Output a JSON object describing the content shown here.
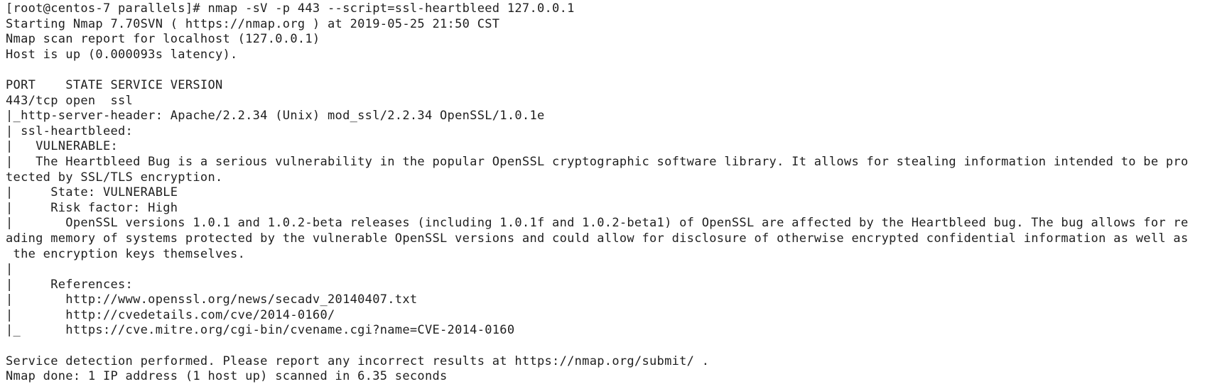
{
  "terminal": {
    "lines": [
      "[root@centos-7 parallels]# nmap -sV -p 443 --script=ssl-heartbleed 127.0.0.1",
      "Starting Nmap 7.70SVN ( https://nmap.org ) at 2019-05-25 21:50 CST",
      "Nmap scan report for localhost (127.0.0.1)",
      "Host is up (0.000093s latency).",
      "",
      "PORT    STATE SERVICE VERSION",
      "443/tcp open  ssl",
      "|_http-server-header: Apache/2.2.34 (Unix) mod_ssl/2.2.34 OpenSSL/1.0.1e",
      "| ssl-heartbleed:",
      "|   VULNERABLE:",
      "|   The Heartbleed Bug is a serious vulnerability in the popular OpenSSL cryptographic software library. It allows for stealing information intended to be pro",
      "tected by SSL/TLS encryption.",
      "|     State: VULNERABLE",
      "|     Risk factor: High",
      "|       OpenSSL versions 1.0.1 and 1.0.2-beta releases (including 1.0.1f and 1.0.2-beta1) of OpenSSL are affected by the Heartbleed bug. The bug allows for re",
      "ading memory of systems protected by the vulnerable OpenSSL versions and could allow for disclosure of otherwise encrypted confidential information as well as",
      " the encryption keys themselves.",
      "|",
      "|     References:",
      "|       http://www.openssl.org/news/secadv_20140407.txt",
      "|       http://cvedetails.com/cve/2014-0160/",
      "|_      https://cve.mitre.org/cgi-bin/cvename.cgi?name=CVE-2014-0160",
      "",
      "Service detection performed. Please report any incorrect results at https://nmap.org/submit/ .",
      "Nmap done: 1 IP address (1 host up) scanned in 6.35 seconds"
    ]
  }
}
